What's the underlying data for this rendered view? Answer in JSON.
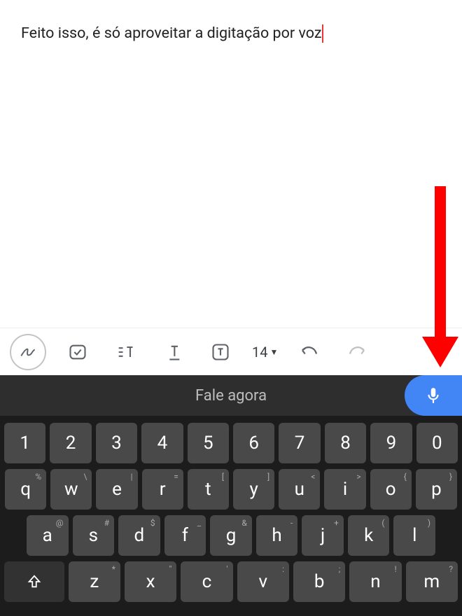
{
  "document": {
    "text": "Feito isso, é só aproveitar a digitação por voz"
  },
  "toolbar": {
    "font_size": "14"
  },
  "voice": {
    "prompt": "Fale agora"
  },
  "keyboard": {
    "row1": [
      {
        "main": "1",
        "sup": ""
      },
      {
        "main": "2",
        "sup": ""
      },
      {
        "main": "3",
        "sup": ""
      },
      {
        "main": "4",
        "sup": ""
      },
      {
        "main": "5",
        "sup": ""
      },
      {
        "main": "6",
        "sup": ""
      },
      {
        "main": "7",
        "sup": ""
      },
      {
        "main": "8",
        "sup": ""
      },
      {
        "main": "9",
        "sup": ""
      },
      {
        "main": "0",
        "sup": ""
      }
    ],
    "row2": [
      {
        "main": "q",
        "sup": "%"
      },
      {
        "main": "w",
        "sup": "\\"
      },
      {
        "main": "e",
        "sup": "|"
      },
      {
        "main": "r",
        "sup": "="
      },
      {
        "main": "t",
        "sup": "["
      },
      {
        "main": "y",
        "sup": "]"
      },
      {
        "main": "u",
        "sup": "<"
      },
      {
        "main": "i",
        "sup": ">"
      },
      {
        "main": "o",
        "sup": "{"
      },
      {
        "main": "p",
        "sup": "}"
      }
    ],
    "row3": [
      {
        "main": "a",
        "sup": "@"
      },
      {
        "main": "s",
        "sup": "#"
      },
      {
        "main": "d",
        "sup": "$"
      },
      {
        "main": "f",
        "sup": "_"
      },
      {
        "main": "g",
        "sup": "&"
      },
      {
        "main": "h",
        "sup": "-"
      },
      {
        "main": "j",
        "sup": "+"
      },
      {
        "main": "k",
        "sup": "("
      },
      {
        "main": "l",
        "sup": ")"
      }
    ],
    "row4": [
      {
        "main": "z",
        "sup": "*"
      },
      {
        "main": "x",
        "sup": "\""
      },
      {
        "main": "c",
        "sup": "'"
      },
      {
        "main": "v",
        "sup": ":"
      },
      {
        "main": "b",
        "sup": ";"
      },
      {
        "main": "n",
        "sup": "!"
      },
      {
        "main": "m",
        "sup": "?"
      }
    ]
  }
}
